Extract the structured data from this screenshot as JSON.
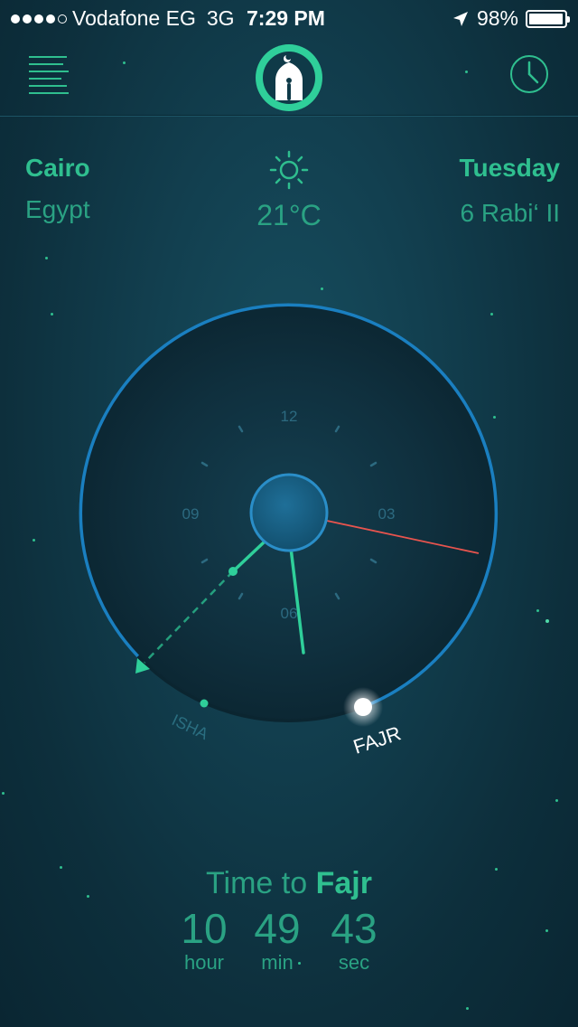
{
  "status_bar": {
    "carrier": "Vodafone EG",
    "network": "3G",
    "time": "7:29 PM",
    "battery": "98%",
    "battery_level": 0.98
  },
  "nav": {
    "menu_icon": "menu-lines-icon",
    "logo_icon": "mosque-logo-icon",
    "clock_icon": "clock-icon"
  },
  "location": {
    "city": "Cairo",
    "country": "Egypt"
  },
  "weather": {
    "icon": "sun-icon",
    "temperature": "21°C"
  },
  "date": {
    "day": "Tuesday",
    "hijri": "6 Rabi‘ II"
  },
  "dial": {
    "labels": {
      "twelve": "12",
      "three": "03",
      "six": "06",
      "nine": "09"
    },
    "prayers": {
      "previous": "ISHA",
      "next": "FAJR"
    },
    "colors": {
      "ring": "#1a7fc0",
      "hand_green": "#2fcf9a",
      "hand_red": "#e8544e"
    }
  },
  "countdown": {
    "prefix": "Time to",
    "prayer": "Fajr",
    "hours": "10",
    "minutes": "49",
    "seconds": "43",
    "hour_label": "hour",
    "min_label": "min",
    "sec_label": "sec"
  }
}
